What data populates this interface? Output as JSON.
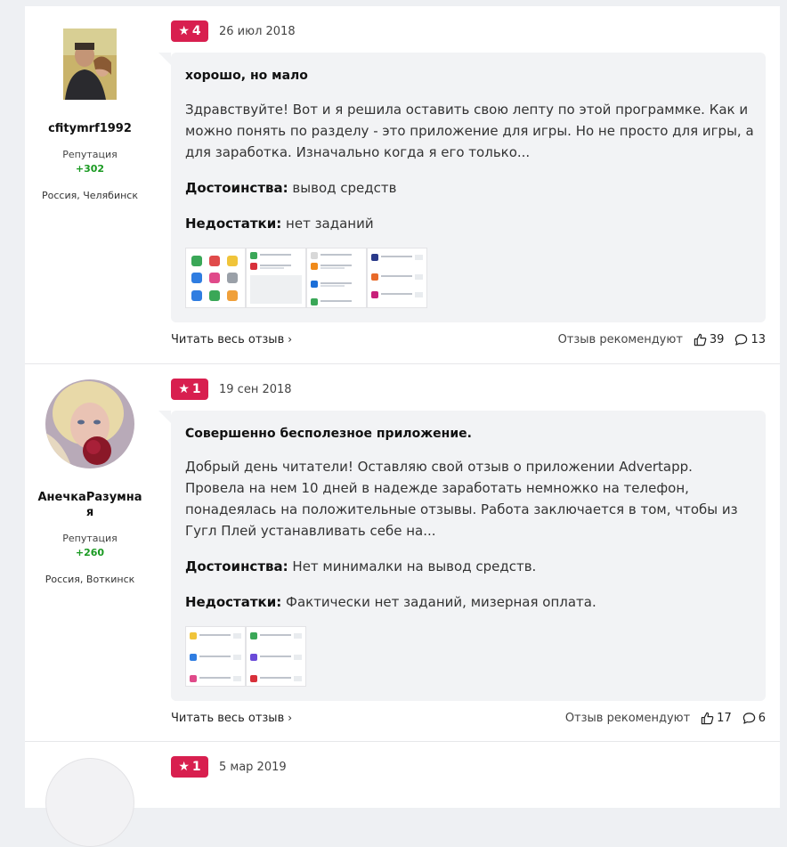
{
  "reviews": [
    {
      "author": "cfitymrf1992",
      "reputation_label": "Репутация",
      "reputation": "+302",
      "location": "Россия, Челябинск",
      "rating": "4",
      "date": "26 июл 2018",
      "title": "хорошо, но мало",
      "text": "Здравствуйте! Вот и я решила оставить свою лепту по этой программке. Как и можно понять по разделу - это приложение для игры. Но не просто для игры, а для заработка. Изначально когда я его только...",
      "pros_label": "Достоинства:",
      "pros": "вывод средств",
      "cons_label": "Недостатки:",
      "cons": "нет заданий",
      "read_more": "Читать весь отзыв",
      "recommend_label": "Отзыв рекомендуют",
      "likes": "39",
      "comments": "13"
    },
    {
      "author": "АнечкаРазумная",
      "reputation_label": "Репутация",
      "reputation": "+260",
      "location": "Россия, Воткинск",
      "rating": "1",
      "date": "19 сен 2018",
      "title": "Совершенно бесполезное приложение.",
      "text": "Добрый день читатели! Оставляю свой отзыв о приложении Advertapp. Провела на нем 10 дней в надежде заработать немножко на телефон, понадеялась на положительные отзывы. Работа заключается в том, чтобы из Гугл Плей устанавливать себе на...",
      "pros_label": "Достоинства:",
      "pros": "Нет минималки на вывод средств.",
      "cons_label": "Недостатки:",
      "cons": "Фактически нет заданий, мизерная оплата.",
      "read_more": "Читать весь отзыв",
      "recommend_label": "Отзыв рекомендуют",
      "likes": "17",
      "comments": "6"
    },
    {
      "rating": "1",
      "date": "5 мар 2019"
    }
  ],
  "colors": {
    "badge": "#d81f4f",
    "reputation": "#1a9a22",
    "bubble": "#f2f3f5"
  }
}
